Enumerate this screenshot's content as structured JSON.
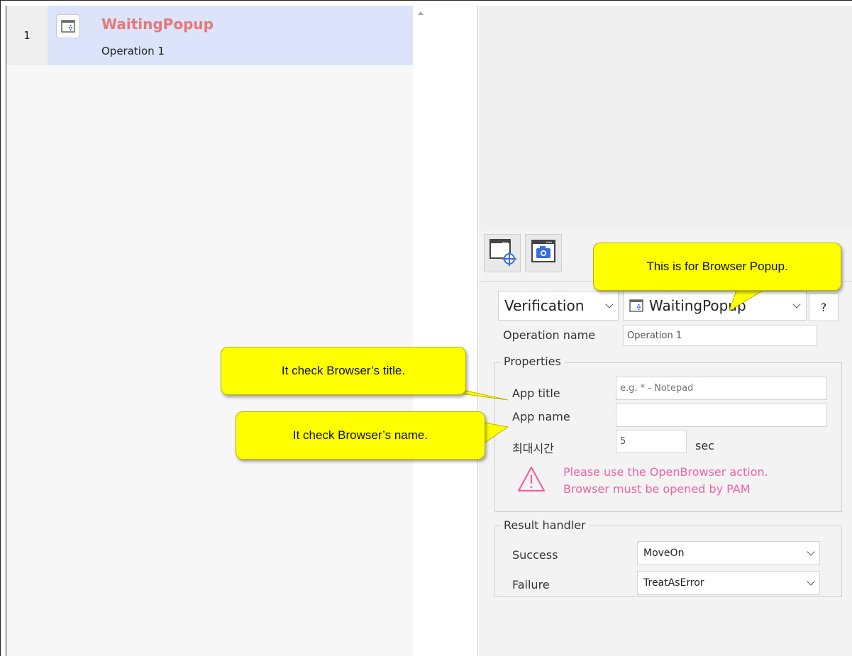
{
  "list": {
    "rows": [
      {
        "number": "1",
        "title": "WaitingPopup",
        "subtitle": "Operation 1"
      }
    ]
  },
  "toolbar": {
    "capture_element_icon": "target-window-icon",
    "capture_screen_icon": "camera-window-icon"
  },
  "action": {
    "type_value": "Verification",
    "target_value": "WaitingPopup",
    "help_label": "?"
  },
  "operation": {
    "label": "Operation name",
    "value": "Operation 1"
  },
  "properties": {
    "legend": "Properties",
    "app_title_label": "App title",
    "app_title_placeholder": "e.g. * - Notepad",
    "app_name_label": "App name",
    "app_name_value": "",
    "max_time_label": "최대시간",
    "max_time_value": "5",
    "max_time_unit": "sec",
    "warning_line1": "Please use the OpenBrowser action.",
    "warning_line2": "Browser must be opened by PAM"
  },
  "result_handler": {
    "legend": "Result handler",
    "success_label": "Success",
    "success_value": "MoveOn",
    "failure_label": "Failure",
    "failure_value": "TreatAsError"
  },
  "callouts": {
    "browser_popup": "This is for Browser Popup.",
    "browser_title": "It check Browser’s title.",
    "browser_name": "It check Browser’s name."
  },
  "colors": {
    "title_accent": "#e87777",
    "warning": "#f062a2",
    "callout": "#ffff00",
    "selected_row": "#dbe4fb"
  }
}
